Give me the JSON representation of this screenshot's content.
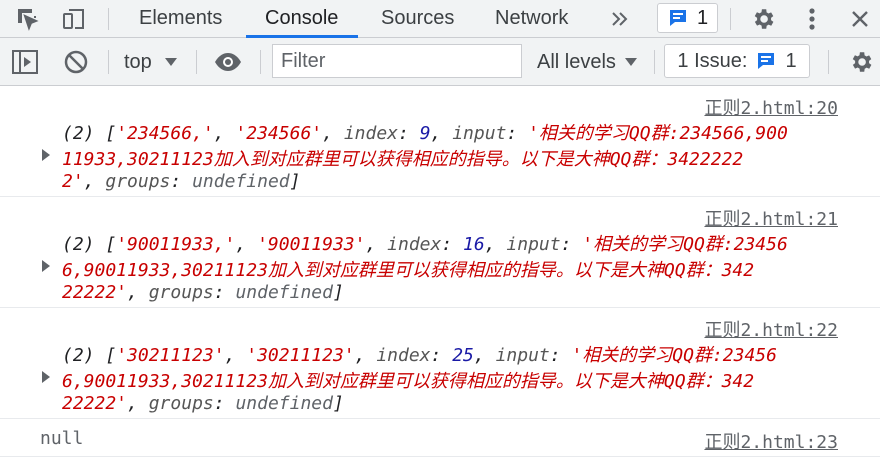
{
  "tabs": [
    {
      "label": "Elements"
    },
    {
      "label": "Console"
    },
    {
      "label": "Sources"
    },
    {
      "label": "Network"
    }
  ],
  "message_badge": {
    "count": "1",
    "color": "#1a73e8"
  },
  "toolbar": {
    "context": "top",
    "filter_placeholder": "Filter",
    "levels": "All levels",
    "issues_label": "1 Issue:",
    "issues_count": "1"
  },
  "messages": [
    {
      "source": "正则2.html:20",
      "prefix": "(2) [",
      "m0": "'234566,'",
      "m1": "'234566'",
      "index_key": "index",
      "index_val": "9",
      "input_key": "input",
      "input_l1": "'相关的学习QQ群:234566,900",
      "input_l2": "11933,30211123加入到对应群里可以获得相应的指导。以下是大神QQ群：3422222",
      "input_l3": "2'",
      "groups_key": "groups",
      "groups_val": "undefined"
    },
    {
      "source": "正则2.html:21",
      "prefix": "(2) [",
      "m0": "'90011933,'",
      "m1": "'90011933'",
      "index_key": "index",
      "index_val": "16",
      "input_key": "input",
      "input_l1": "'相关的学习QQ群:23456",
      "input_l2": "6,90011933,30211123加入到对应群里可以获得相应的指导。以下是大神QQ群：342",
      "input_l3": "22222'",
      "groups_key": "groups",
      "groups_val": "undefined"
    },
    {
      "source": "正则2.html:22",
      "prefix": "(2) [",
      "m0": "'30211123'",
      "m1": "'30211123'",
      "index_key": "index",
      "index_val": "25",
      "input_key": "input",
      "input_l1": "'相关的学习QQ群:23456",
      "input_l2": "6,90011933,30211123加入到对应群里可以获得相应的指导。以下是大神QQ群：342",
      "input_l3": "22222'",
      "groups_key": "groups",
      "groups_val": "undefined"
    }
  ],
  "null_message": {
    "text": "null",
    "source": "正则2.html:23"
  }
}
